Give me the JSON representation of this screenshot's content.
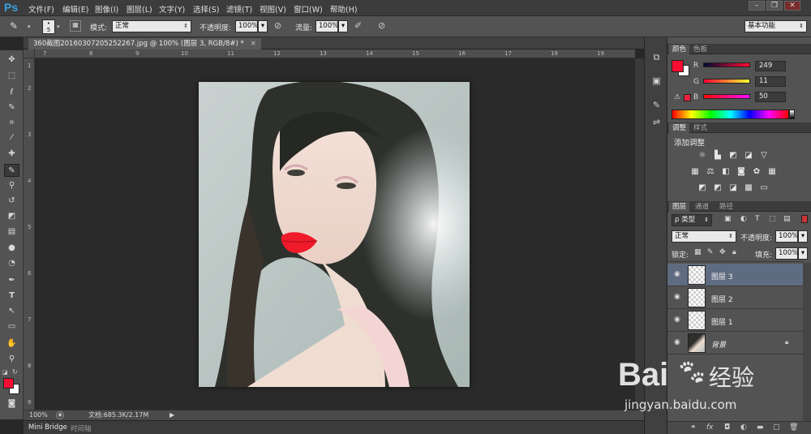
{
  "app": {
    "logo": "Ps"
  },
  "menu": [
    "文件(F)",
    "编辑(E)",
    "图像(I)",
    "图层(L)",
    "文字(Y)",
    "选择(S)",
    "滤镜(T)",
    "视图(V)",
    "窗口(W)",
    "帮助(H)"
  ],
  "window_controls": {
    "minimize": "–",
    "restore": "❐",
    "close": "✕"
  },
  "options": {
    "brush_size": "5",
    "mode_label": "模式:",
    "mode_value": "正常",
    "opacity_label": "不透明度:",
    "opacity_value": "100%",
    "flow_label": "流量:",
    "flow_value": "100%",
    "workspace": "基本功能"
  },
  "document": {
    "tab_title": "360截图20160307205252267.jpg @ 100% (图层 3, RGB/8#) *",
    "zoom": "100%",
    "doc_size": "文档:685.3K/2.17M"
  },
  "ruler_h": [
    "7",
    "8",
    "9",
    "10",
    "11",
    "12",
    "13",
    "14",
    "15",
    "16",
    "17",
    "18",
    "19"
  ],
  "ruler_v": [
    "1",
    "2",
    "3",
    "4",
    "5",
    "6",
    "7",
    "8",
    "9"
  ],
  "bottom_tabs": [
    "Mini Bridge",
    "时间轴"
  ],
  "color_panel": {
    "tabs": [
      "颜色",
      "色板"
    ],
    "r_label": "R",
    "r_value": "249",
    "g_label": "G",
    "g_value": "11",
    "b_label": "B",
    "b_value": "50",
    "foreground_hex": "#f90b32",
    "background_hex": "#ffffff"
  },
  "adjust_panel": {
    "tabs": [
      "调整",
      "样式"
    ],
    "title": "添加调整"
  },
  "layers_panel": {
    "tabs": [
      "图层",
      "通道",
      "路径"
    ],
    "kind_label": "ρ 类型",
    "blend_mode": "正常",
    "opacity_label": "不透明度:",
    "opacity_value": "100%",
    "lock_label": "锁定:",
    "fill_label": "填充:",
    "fill_value": "100%",
    "layers": [
      {
        "name": "图层 3",
        "selected": true
      },
      {
        "name": "图层 2",
        "selected": false
      },
      {
        "name": "图层 1",
        "selected": false
      },
      {
        "name": "背景",
        "selected": false
      }
    ]
  },
  "watermark": {
    "brand": "Bai",
    "brand2": "经验",
    "url": "jingyan.baidu.com"
  }
}
